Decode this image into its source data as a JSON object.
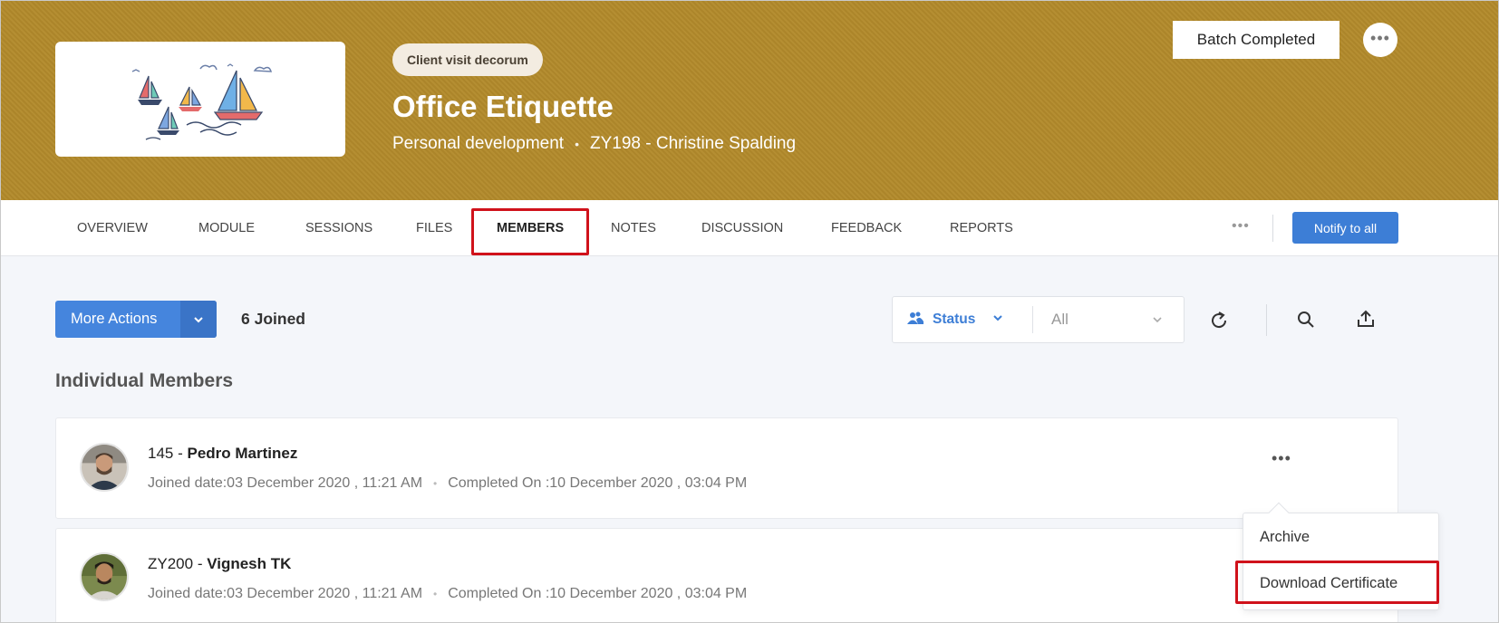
{
  "header": {
    "tag": "Client visit decorum",
    "title": "Office Etiquette",
    "category": "Personal development",
    "separator": "•",
    "owner": "ZY198 - Christine Spalding",
    "batch_button": "Batch Completed",
    "more": "•••",
    "banner_color": "#b28a2b"
  },
  "tabs": [
    {
      "label": "OVERVIEW"
    },
    {
      "label": "MODULE"
    },
    {
      "label": "SESSIONS"
    },
    {
      "label": "FILES"
    },
    {
      "label": "MEMBERS"
    },
    {
      "label": "NOTES"
    },
    {
      "label": "DISCUSSION"
    },
    {
      "label": "FEEDBACK"
    },
    {
      "label": "REPORTS"
    }
  ],
  "tabs_more": "•••",
  "notify_button": "Notify to all",
  "toolbar": {
    "more_actions": "More Actions",
    "joined_count": "6 Joined",
    "filter_label": "Status",
    "filter_value": "All",
    "accent": "#4585dd"
  },
  "section_title": "Individual Members",
  "members": [
    {
      "id": "145",
      "name": "Pedro Martinez",
      "joined": "Joined date:03 December 2020 , 11:21 AM",
      "completed": "Completed On :10 December 2020 , 03:04 PM"
    },
    {
      "id": "ZY200",
      "name": "Vignesh TK",
      "joined": "Joined date:03 December 2020 , 11:21 AM",
      "completed": "Completed On :10 December 2020 , 03:04 PM"
    }
  ],
  "row_more": "•••",
  "menu": {
    "archive": "Archive",
    "download": "Download Certificate"
  },
  "highlight_color": "#d0121b"
}
